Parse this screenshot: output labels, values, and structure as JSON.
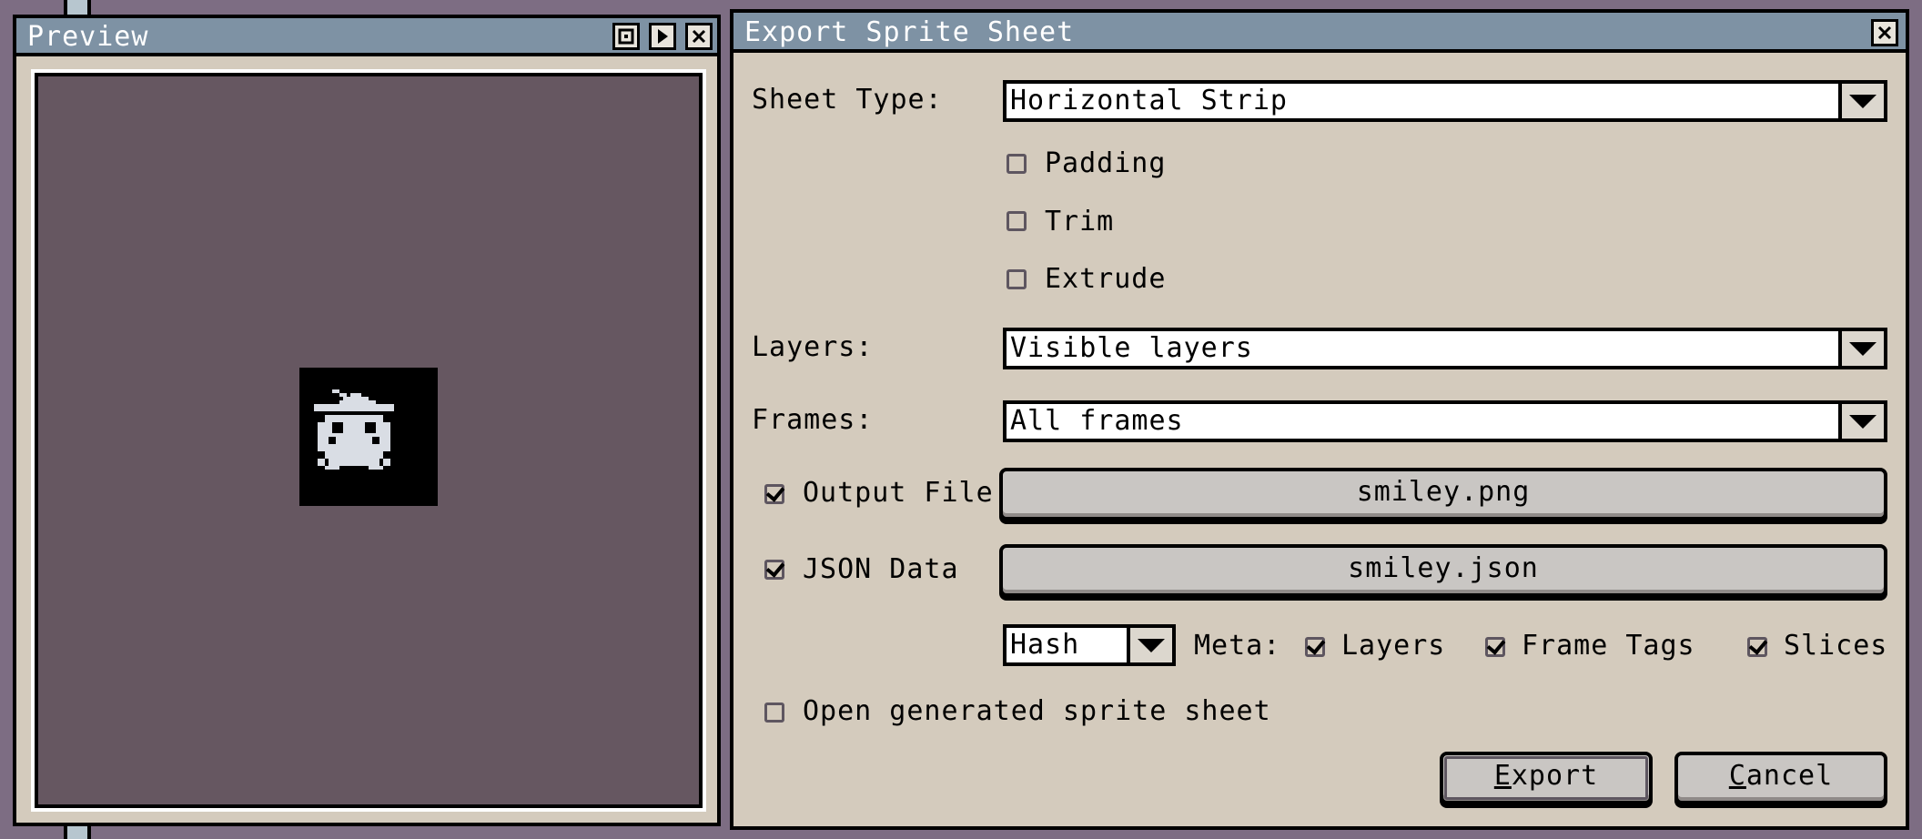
{
  "preview": {
    "title": "Preview",
    "buttons": [
      "fit-icon",
      "play-icon",
      "close-icon"
    ]
  },
  "dialog": {
    "title": "Export Sprite Sheet",
    "sheet_type_label": "Sheet Type:",
    "sheet_type_value": "Horizontal Strip",
    "padding_label": "Padding",
    "trim_label": "Trim",
    "extrude_label": "Extrude",
    "layers_label": "Layers:",
    "layers_value": "Visible layers",
    "frames_label": "Frames:",
    "frames_value": "All frames",
    "output_file_label": "Output File",
    "output_file_value": "smiley.png",
    "json_data_label": "JSON Data",
    "json_data_value": "smiley.json",
    "json_format_value": "Hash",
    "meta_label": "Meta:",
    "meta_layers_label": "Layers",
    "meta_frame_tags_label": "Frame Tags",
    "meta_slices_label": "Slices",
    "open_generated_label": "Open generated sprite sheet",
    "export_label_first": "E",
    "export_label_rest": "xport",
    "cancel_label_first": "C",
    "cancel_label_rest": "ancel"
  },
  "colors": {
    "background": "#7d6d83",
    "panel": "#d4cbbd",
    "titlebar": "#7e92a4",
    "canvas": "#665761"
  }
}
